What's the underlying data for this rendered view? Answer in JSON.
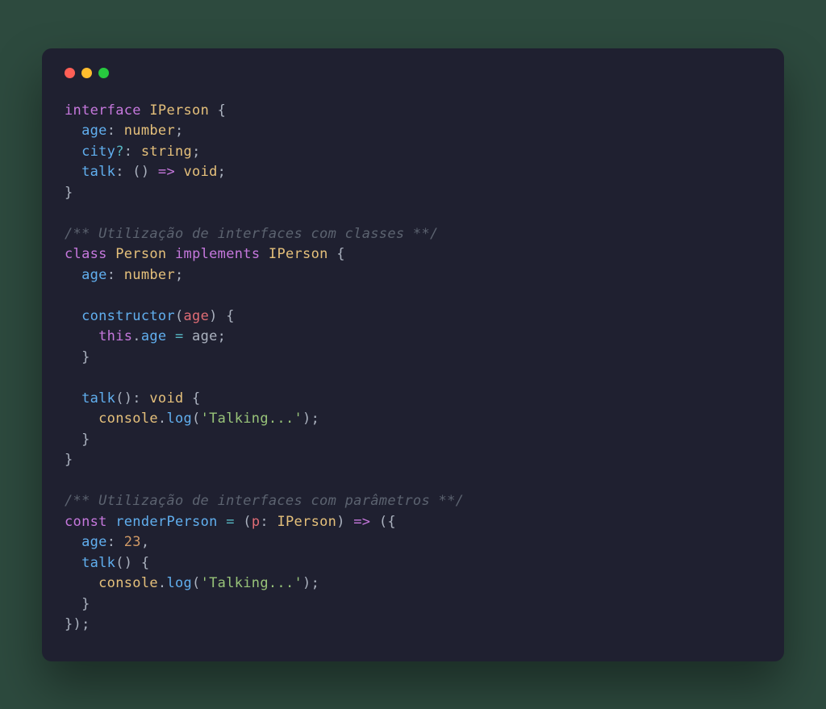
{
  "code": {
    "line1_kw_interface": "interface",
    "line1_type_IPerson": "IPerson",
    "line1_brace_open": " {",
    "line2_prop_age": "  age",
    "line2_colon": ": ",
    "line2_type_number": "number",
    "line2_semi": ";",
    "line3_prop_city": "  city",
    "line3_optional": "?",
    "line3_colon": ": ",
    "line3_type_string": "string",
    "line3_semi": ";",
    "line4_prop_talk": "  talk",
    "line4_colon": ": ",
    "line4_paren": "()",
    "line4_arrow": " => ",
    "line4_type_void": "void",
    "line4_semi": ";",
    "line5_brace_close": "}",
    "line7_comment": "/** Utilização de interfaces com classes **/",
    "line8_kw_class": "class",
    "line8_type_Person": "Person",
    "line8_kw_implements": "implements",
    "line8_type_IPerson": "IPerson",
    "line8_brace_open": " {",
    "line9_prop_age": "  age",
    "line9_colon": ": ",
    "line9_type_number": "number",
    "line9_semi": ";",
    "line11_ctor": "  constructor",
    "line11_paren_open": "(",
    "line11_param_age": "age",
    "line11_paren_close": ")",
    "line11_brace": " {",
    "line12_indent": "    ",
    "line12_this": "this",
    "line12_dot": ".",
    "line12_prop_age": "age",
    "line12_eq": " = ",
    "line12_var_age": "age",
    "line12_semi": ";",
    "line13_brace_close": "  }",
    "line15_prop_talk": "  talk",
    "line15_parens": "()",
    "line15_colon": ": ",
    "line15_type_void": "void",
    "line15_brace": " {",
    "line16_indent": "    ",
    "line16_console": "console",
    "line16_dot": ".",
    "line16_log": "log",
    "line16_paren_open": "(",
    "line16_str": "'Talking...'",
    "line16_paren_close": ")",
    "line16_semi": ";",
    "line17_brace_close": "  }",
    "line18_brace_close": "}",
    "line20_comment": "/** Utilização de interfaces com parâmetros **/",
    "line21_kw_const": "const",
    "line21_fn_renderPerson": "renderPerson",
    "line21_eq": " = ",
    "line21_paren_open": "(",
    "line21_param_p": "p",
    "line21_colon": ": ",
    "line21_type_IPerson": "IPerson",
    "line21_paren_close": ")",
    "line21_arrow": " => ",
    "line21_paren_open2": "(",
    "line21_brace_open": "{",
    "line22_prop_age": "  age",
    "line22_colon": ": ",
    "line22_num": "23",
    "line22_comma": ",",
    "line23_prop_talk": "  talk",
    "line23_parens": "()",
    "line23_brace": " {",
    "line24_indent": "    ",
    "line24_console": "console",
    "line24_dot": ".",
    "line24_log": "log",
    "line24_paren_open": "(",
    "line24_str": "'Talking...'",
    "line24_paren_close": ")",
    "line24_semi": ";",
    "line25_brace_close": "  }",
    "line26_brace_close": "}",
    "line26_paren_close": ")",
    "line26_semi": ";"
  }
}
